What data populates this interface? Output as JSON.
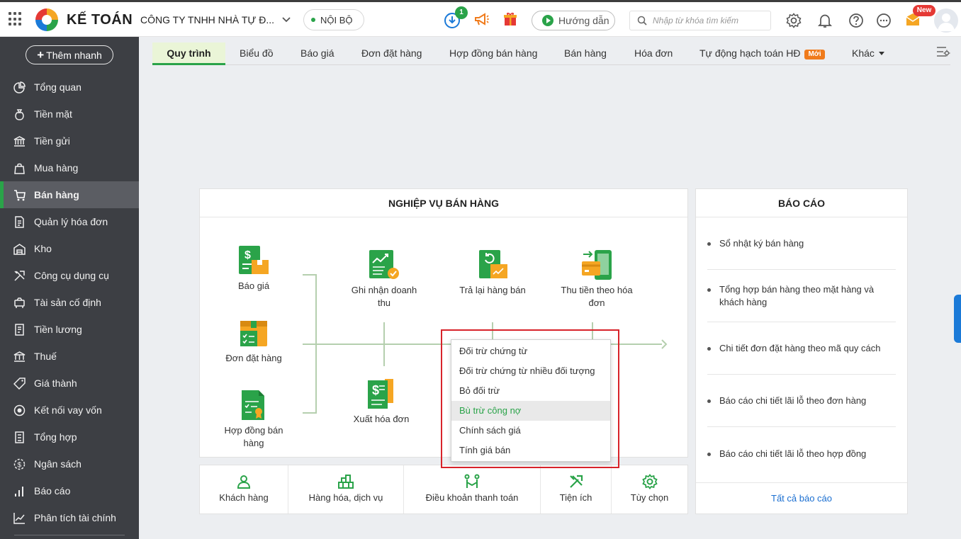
{
  "header": {
    "logo_text": "KẾ TOÁN",
    "company_name": "CÔNG TY TNHH NHÀ TỰ Đ...",
    "environment": "NỘI BỘ",
    "download_badge": "1",
    "guide_label": "Hướng dẫn",
    "search_placeholder": "Nhập từ khóa tìm kiếm",
    "new_badge": "New"
  },
  "sidebar": {
    "quick_add": "Thêm nhanh",
    "items": [
      {
        "label": "Tổng quan",
        "icon": "pie-chart-icon"
      },
      {
        "label": "Tiền mặt",
        "icon": "money-bag-icon"
      },
      {
        "label": "Tiền gửi",
        "icon": "bank-icon"
      },
      {
        "label": "Mua hàng",
        "icon": "shopping-bag-icon"
      },
      {
        "label": "Bán hàng",
        "icon": "cart-icon",
        "active": true
      },
      {
        "label": "Quản lý hóa đơn",
        "icon": "invoice-icon"
      },
      {
        "label": "Kho",
        "icon": "warehouse-icon"
      },
      {
        "label": "Công cụ dụng cụ",
        "icon": "tools-icon"
      },
      {
        "label": "Tài sản cố định",
        "icon": "asset-icon"
      },
      {
        "label": "Tiền lương",
        "icon": "salary-icon"
      },
      {
        "label": "Thuế",
        "icon": "tax-icon"
      },
      {
        "label": "Giá thành",
        "icon": "price-tag-icon"
      },
      {
        "label": "Kết nối vay vốn",
        "icon": "loan-icon"
      },
      {
        "label": "Tổng hợp",
        "icon": "summary-icon"
      },
      {
        "label": "Ngân sách",
        "icon": "budget-icon"
      },
      {
        "label": "Báo cáo",
        "icon": "bar-chart-icon"
      },
      {
        "label": "Phân tích tài chính",
        "icon": "trend-chart-icon"
      }
    ]
  },
  "tabs": [
    {
      "label": "Quy trình",
      "active": true
    },
    {
      "label": "Biểu đồ"
    },
    {
      "label": "Báo giá"
    },
    {
      "label": "Đơn đặt hàng"
    },
    {
      "label": "Hợp đồng bán hàng"
    },
    {
      "label": "Bán hàng"
    },
    {
      "label": "Hóa đơn"
    },
    {
      "label": "Tự động hạch toán HĐ",
      "tag": "Mới"
    },
    {
      "label": "Khác"
    }
  ],
  "flow": {
    "title": "NGHIỆP VỤ BÁN HÀNG",
    "nodes": {
      "quote": "Báo giá",
      "order": "Đơn đặt hàng",
      "contract": "Hợp đồng bán hàng",
      "revenue": "Ghi nhận doanh thu",
      "invoice": "Xuất hóa đơn",
      "return": "Trả lại hàng bán",
      "collect": "Thu tiền theo hóa đơn"
    }
  },
  "context_menu": {
    "items": [
      "Đối trừ chứng từ",
      "Đối trừ chứng từ nhiều đối tượng",
      "Bỏ đối trừ",
      "Bù trừ công nợ",
      "Chính sách giá",
      "Tính giá bán"
    ],
    "hover_index": 3
  },
  "bottom_bar": [
    {
      "label": "Khách hàng",
      "icon": "customer-icon"
    },
    {
      "label": "Hàng hóa, dịch vụ",
      "icon": "goods-icon"
    },
    {
      "label": "Điều khoản thanh toán",
      "icon": "payment-terms-icon"
    },
    {
      "label": "Tiện ích",
      "icon": "utilities-icon"
    },
    {
      "label": "Tùy chọn",
      "icon": "options-gear-icon"
    }
  ],
  "reports": {
    "title": "BÁO CÁO",
    "items": [
      "Sổ nhật ký bán hàng",
      "Tổng hợp bán hàng theo mặt hàng và khách hàng",
      "Chi tiết đơn đặt hàng theo mã quy cách",
      "Báo cáo chi tiết lãi lỗ theo đơn hàng",
      "Báo cáo chi tiết lãi lỗ theo hợp đồng"
    ],
    "all_link": "Tất cả báo cáo"
  },
  "colors": {
    "brand_green": "#2aa349",
    "sidebar_bg": "#3d3f44",
    "highlight_red": "#d8232a",
    "link_blue": "#1b6fd1"
  }
}
